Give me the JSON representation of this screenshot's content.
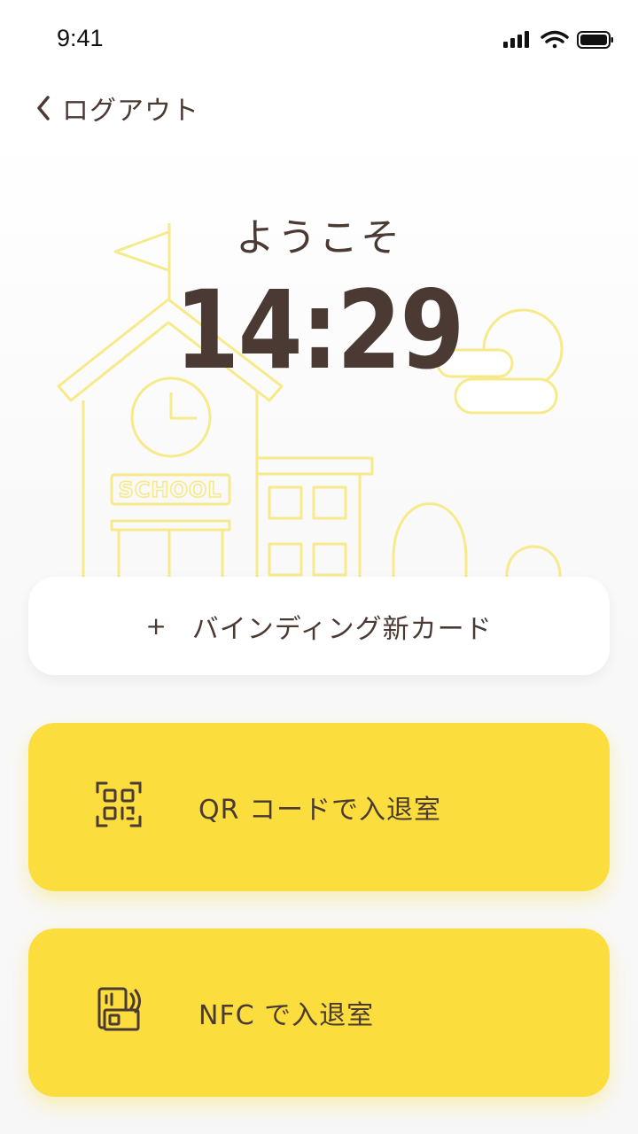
{
  "status_bar": {
    "time": "9:41"
  },
  "nav": {
    "back_label": "ログアウト"
  },
  "header": {
    "welcome": "ようこそ",
    "clock": "14:29"
  },
  "illustration": {
    "sign_text": "SCHOOL"
  },
  "bind_card": {
    "plus": "+",
    "label": "バインディング新カード"
  },
  "actions": [
    {
      "label": "QR コードで入退室",
      "icon": "qr-code-icon"
    },
    {
      "label": "NFC で入退室",
      "icon": "nfc-card-icon"
    }
  ],
  "colors": {
    "accent": "#fbdd3e",
    "text": "#4a3a33",
    "illustration_line": "#f7ea8a"
  }
}
